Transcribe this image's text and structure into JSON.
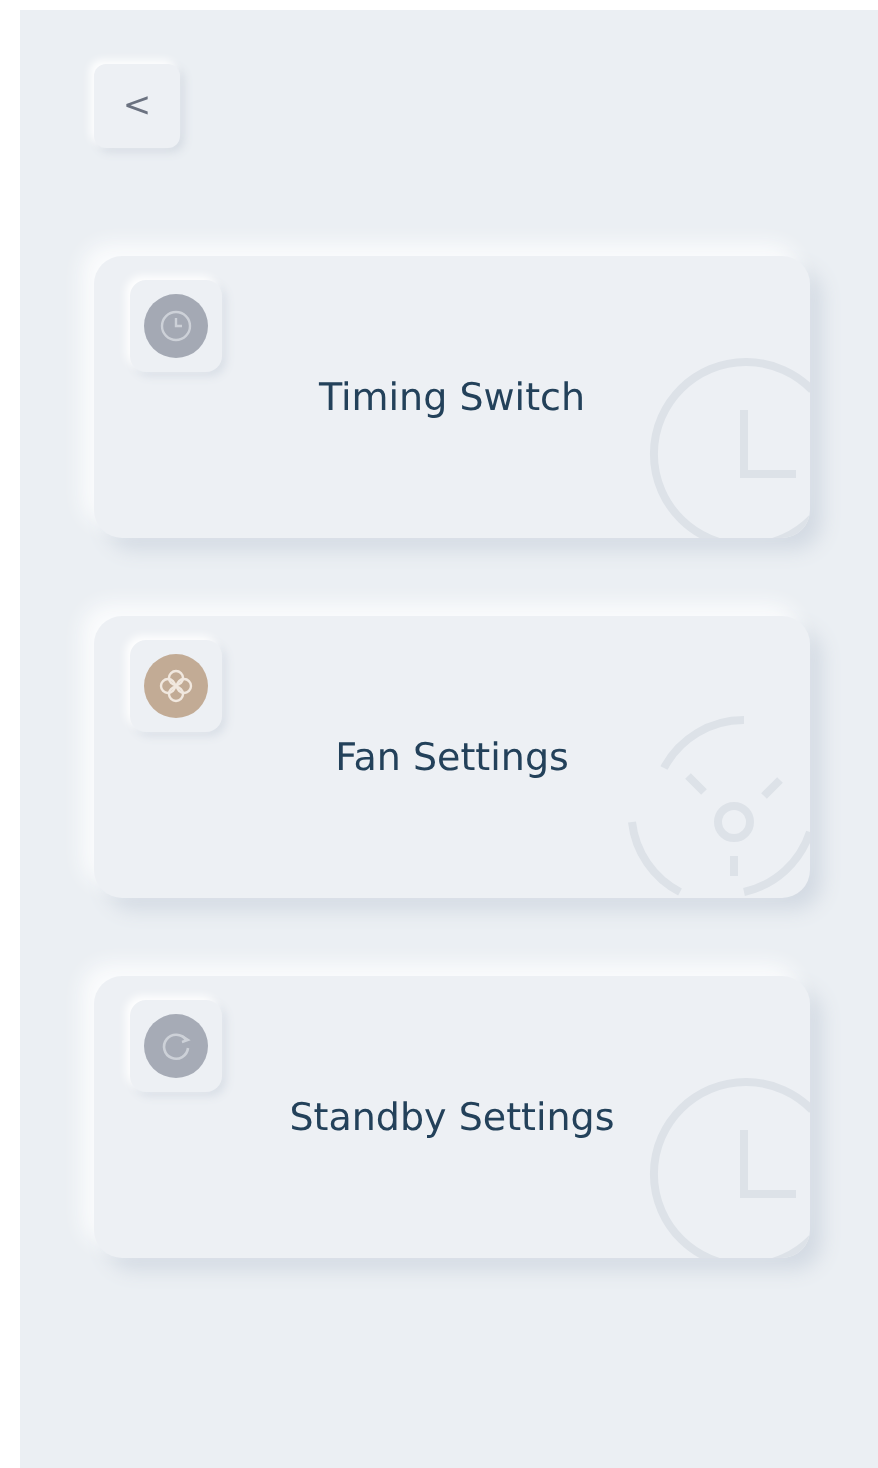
{
  "back_button": {
    "label": "<"
  },
  "cards": [
    {
      "title": "Timing Switch",
      "kind": "clock",
      "color": "#a4a9b4"
    },
    {
      "title": "Fan Settings",
      "kind": "fan",
      "color": "#c2ab95"
    },
    {
      "title": "Standby Settings",
      "kind": "standby",
      "color": "#a6abb6"
    }
  ]
}
